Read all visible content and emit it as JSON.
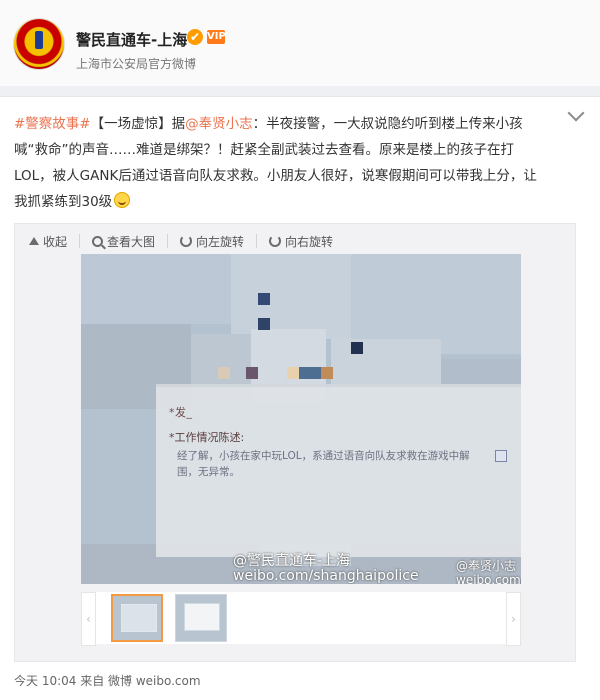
{
  "header": {
    "account_name": "警民直通车-上海",
    "subtitle": "上海市公安局官方微博"
  },
  "post": {
    "line1": "#警察故事#【一场虚惊】据@奉贤小志：半夜接警，一大叔说隐约听到楼上传来小孩",
    "line2": "喊“救命”的声音……难道是绑架？！赶紧全副武装过去查看。原来是楼上的孩子在打",
    "line3": "LOL，被人GANK后通过语音向队友求救。小朋友人很好，说寒假期间可以带我上分，让",
    "line4": "我抓紧练到30级",
    "tag": "#警察故事#",
    "mention": "@奉贤小志"
  },
  "viewer": {
    "toolbar": {
      "collapse": "收起",
      "view_large": "查看大图",
      "rotate_left": "向左旋转",
      "rotate_right": "向右旋转"
    },
    "image": {
      "label1": "*发_",
      "label2": "*工作情况陈述:",
      "content": "经了解，小孩在家中玩LOL，系通过语音向队友求救在游戏中解围，无异常。",
      "watermark_left_1": "@警民直通车-上海",
      "watermark_left_2": "weibo.com/shanghaipolice",
      "watermark_right_1": "@奉贤小志",
      "watermark_right_2": "weibo.com/fxpcs"
    }
  },
  "meta": {
    "time_source": "今天 10:04 来自 微博 weibo.com"
  },
  "colors": {
    "link": "#eb7350",
    "verified": "#ff9d00"
  },
  "icons": {
    "verified": "✔",
    "vip": "VIP",
    "prev": "‹",
    "next": "›"
  }
}
